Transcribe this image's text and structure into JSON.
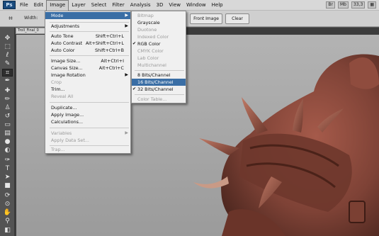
{
  "app": {
    "logo": "Ps",
    "menus": [
      "File",
      "Edit",
      "Image",
      "Layer",
      "Select",
      "Filter",
      "Analysis",
      "3D",
      "View",
      "Window",
      "Help"
    ],
    "zoom": "33,3"
  },
  "options": {
    "width_label": "Width:",
    "front_image": "Front Image",
    "clear": "Clear"
  },
  "document": {
    "tab_title": "Troll_Final_0"
  },
  "image_menu": {
    "mode": "Mode",
    "adjustments": "Adjustments",
    "auto_tone": {
      "label": "Auto Tone",
      "shortcut": "Shift+Ctrl+L"
    },
    "auto_contrast": {
      "label": "Auto Contrast",
      "shortcut": "Alt+Shift+Ctrl+L"
    },
    "auto_color": {
      "label": "Auto Color",
      "shortcut": "Shift+Ctrl+B"
    },
    "image_size": {
      "label": "Image Size...",
      "shortcut": "Alt+Ctrl+I"
    },
    "canvas_size": {
      "label": "Canvas Size...",
      "shortcut": "Alt+Ctrl+C"
    },
    "image_rotation": "Image Rotation",
    "crop": "Crop",
    "trim": "Trim...",
    "reveal_all": "Reveal All",
    "duplicate": "Duplicate...",
    "apply_image": "Apply Image...",
    "calculations": "Calculations...",
    "variables": "Variables",
    "apply_data_set": "Apply Data Set...",
    "trap": "Trap..."
  },
  "mode_menu": {
    "bitmap": "Bitmap",
    "grayscale": "Grayscale",
    "duotone": "Duotone",
    "indexed_color": "Indexed Color",
    "rgb_color": "RGB Color",
    "cmyk_color": "CMYK Color",
    "lab_color": "Lab Color",
    "multichannel": "Multichannel",
    "bits_8": "8 Bits/Channel",
    "bits_16": "16 Bits/Channel",
    "bits_32": "32 Bits/Channel",
    "color_table": "Color Table...",
    "checked": "✔"
  },
  "colors": {
    "highlight": "#3a6ea5",
    "creature": "#8a4a3e"
  }
}
